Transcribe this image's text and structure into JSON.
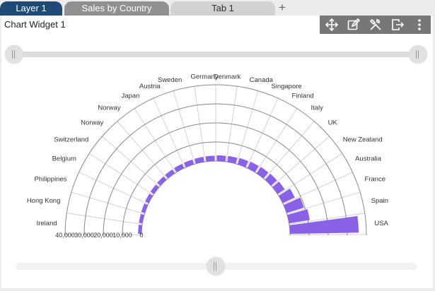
{
  "tabs": [
    {
      "label": "Layer 1"
    },
    {
      "label": "Sales by Country"
    },
    {
      "label": "Tab 1"
    }
  ],
  "add_tab_label": "+",
  "widget": {
    "title": "Chart Widget 1"
  },
  "toolbar": {
    "icons": [
      "move-icon",
      "edit-icon",
      "settings-tools-icon",
      "export-icon",
      "more-vertical-icon"
    ]
  },
  "colors": {
    "bar": "#8a62e8",
    "grid": "#c8c8c8",
    "ring": "#888888",
    "tab_active": "#1e4a76"
  },
  "chart_data": {
    "type": "bar",
    "layout": "radial",
    "categories": [
      "USA",
      "Spain",
      "France",
      "Australia",
      "New Zealand",
      "UK",
      "Italy",
      "Finland",
      "Singapore",
      "Canada",
      "Denmark",
      "Germany",
      "Sweden",
      "Austria",
      "Japan",
      "Norway",
      "Norway",
      "Switzerland",
      "Belgium",
      "Philippines",
      "Hong Kong",
      "Ireland"
    ],
    "values": [
      36000,
      11000,
      9500,
      7000,
      4500,
      4200,
      4000,
      3800,
      3500,
      3200,
      3000,
      2800,
      2700,
      2600,
      2500,
      2400,
      2300,
      2200,
      2100,
      2000,
      1900,
      1800
    ],
    "radial_ticks": [
      "0",
      "10,000",
      "20,000",
      "30,000",
      "40,000"
    ],
    "ylim": [
      0,
      40000
    ],
    "grid": true
  }
}
